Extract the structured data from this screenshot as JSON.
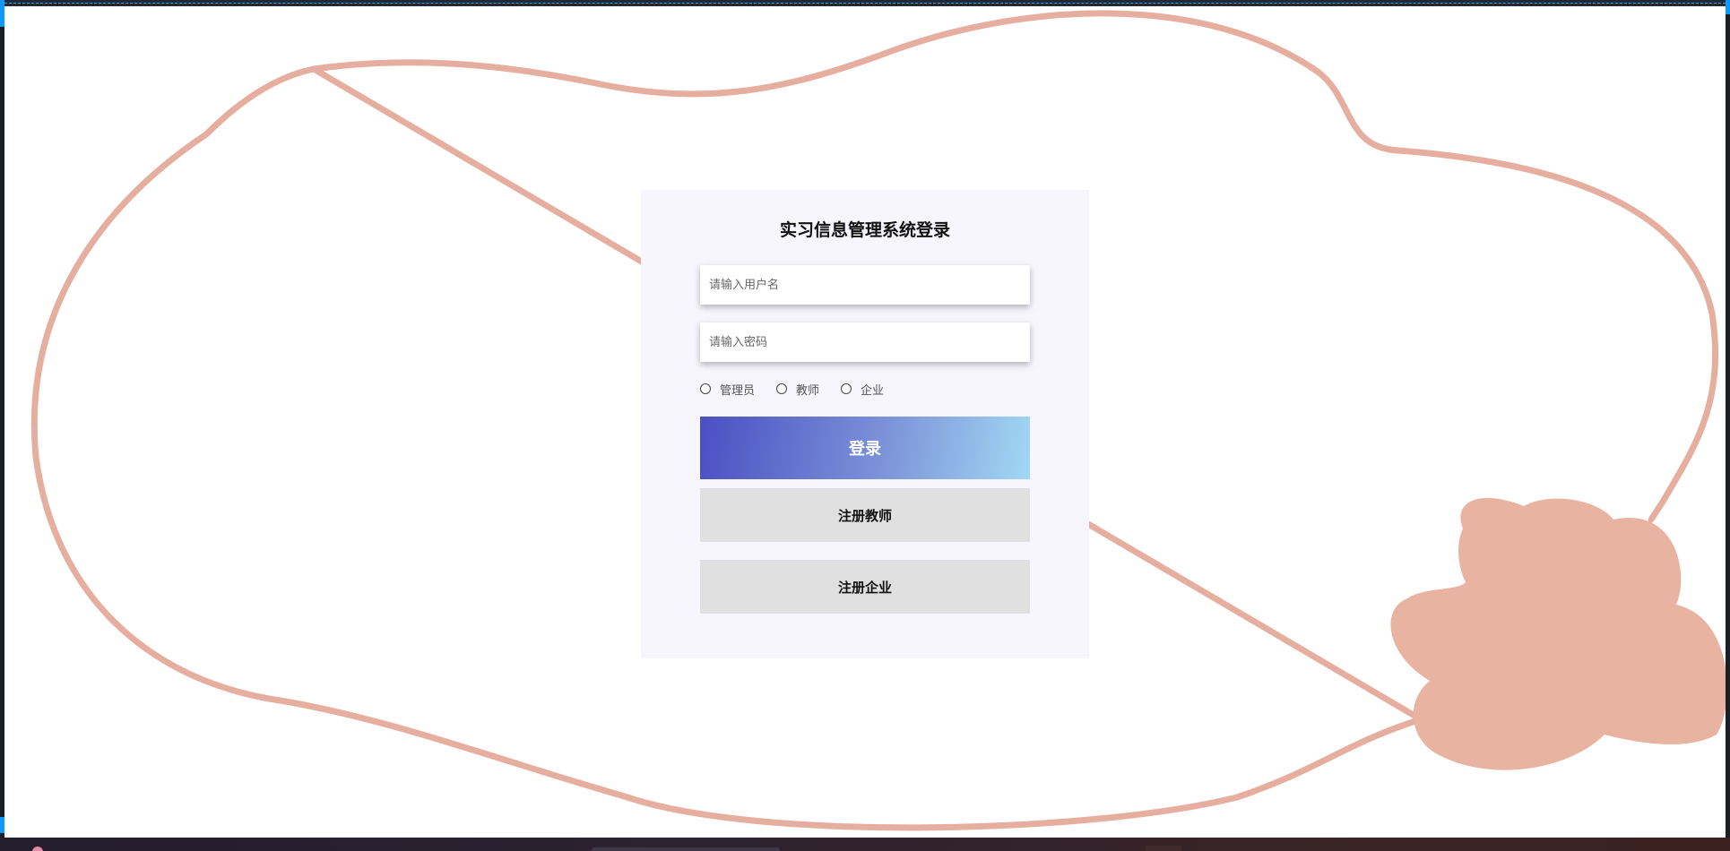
{
  "login": {
    "title": "实习信息管理系统登录",
    "username_placeholder": "请输入用户名",
    "password_placeholder": "请输入密码",
    "roles": [
      "管理员",
      "教师",
      "企业"
    ],
    "login_button": "登录",
    "register_teacher_button": "注册教师",
    "register_company_button": "注册企业"
  },
  "colors": {
    "blob_outline": "#e6ae9f",
    "blob_fill": "#e8b3a0",
    "card_background": "#f7f5fd",
    "login_gradient_start": "#4a4fc3",
    "login_gradient_end": "#a2d8f3",
    "secondary_button": "#e0e0e0"
  }
}
